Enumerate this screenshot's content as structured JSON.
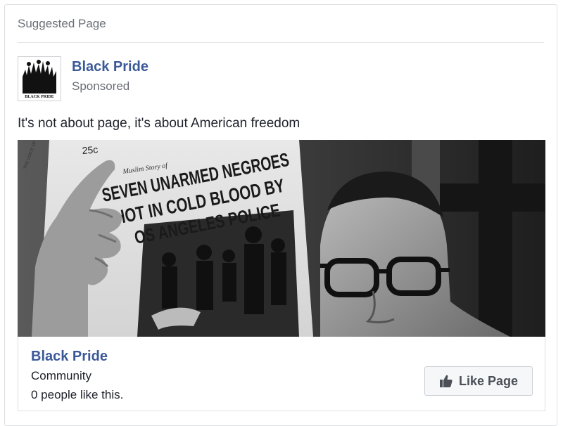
{
  "header": {
    "label": "Suggested Page"
  },
  "page": {
    "name": "Black Pride",
    "sponsored_label": "Sponsored",
    "logo_text": "BLACK PRIDE"
  },
  "post": {
    "text": "It's not about page, it's about American freedom"
  },
  "media": {
    "newspaper_price": "25c",
    "newspaper_kicker": "Muslim Story of",
    "headline_1": "SEVEN UNARMED NEGROES",
    "headline_2": "HOT IN COLD BLOOD BY",
    "headline_3": "OS ANGELES POLICE",
    "corner_text": "THE VOICE OF"
  },
  "footer": {
    "page_name": "Black Pride",
    "category": "Community",
    "likes_text": "0 people like this.",
    "like_button_label": "Like Page",
    "like_icon": "thumbs-up-icon"
  },
  "colors": {
    "link_blue": "#3b5998",
    "text_gray": "#6b6f76",
    "text_dark": "#1d2129",
    "button_bg": "#f6f7f9",
    "border": "#dddfe2"
  }
}
